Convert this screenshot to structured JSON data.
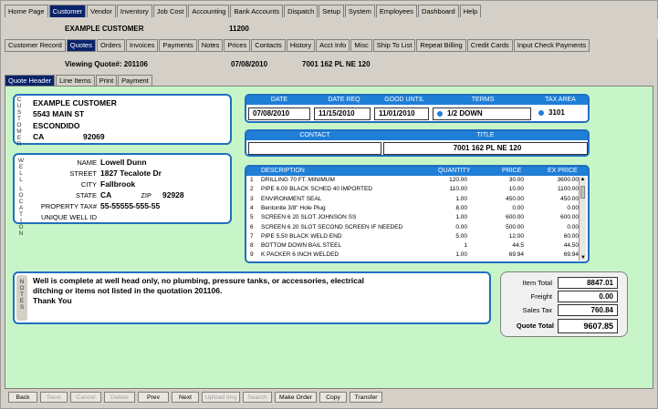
{
  "menu": [
    "Home Page",
    "Customer",
    "Vendor",
    "Inventory",
    "Job Cost",
    "Accounting",
    "Bank Accounts",
    "Dispatch",
    "Setup",
    "System",
    "Employees",
    "Dashboard",
    "Help"
  ],
  "header": {
    "customer_name": "EXAMPLE CUSTOMER",
    "customer_id": "11200"
  },
  "subtabs": [
    "Customer Record",
    "Quotes",
    "Orders",
    "Invoices",
    "Payments",
    "Notes",
    "Prices",
    "Contacts",
    "History",
    "Acct Info",
    "Misc",
    "Ship To List",
    "Repeat Billing",
    "Credit Cards",
    "Input Check Payments"
  ],
  "quote_header": {
    "viewing": "Viewing Quote#: 201106",
    "date": "07/08/2010",
    "address": "7001 162 PL NE  120"
  },
  "quote_tabs": [
    "Quote Header",
    "Line Items",
    "Print",
    "Payment"
  ],
  "customer": {
    "vertical_label": "CUSTOMER",
    "name": "EXAMPLE CUSTOMER",
    "street": "5543 MAIN ST",
    "city": "ESCONDIDO",
    "state": "CA",
    "zip": "92069"
  },
  "well": {
    "vertical_label": "WELL LOCATION",
    "name_label": "NAME",
    "name": "Lowell Dunn",
    "street_label": "STREET",
    "street": "1827 Tecalote Dr",
    "city_label": "CITY",
    "city": "Fallbrook",
    "state_label": "STATE",
    "state": "CA",
    "zip_label": "ZIP",
    "zip": "92928",
    "tax_label": "PROPERTY TAX#",
    "tax": "55-55555-555-55",
    "unique_label": "UNIQUE WELL ID",
    "unique": ""
  },
  "info": {
    "date_label": "DATE",
    "date_req_label": "DATE REQ",
    "good_until_label": "GOOD UNTIL",
    "terms_label": "TERMS",
    "tax_area_label": "TAX AREA",
    "date": "07/08/2010",
    "date_req": "11/15/2010",
    "good_until": "11/01/2010",
    "terms": "1/2 DOWN",
    "tax_area": "3101",
    "contact_label": "CONTACT",
    "title_label": "TITLE",
    "contact": "",
    "title": "7001 162 PL NE  120"
  },
  "items": {
    "headers": [
      "DESCRIPTION",
      "QUANTITY",
      "PRICE",
      "EX PRICE"
    ],
    "rows": [
      [
        "1",
        "DRILLING  70 FT. MINIMUM",
        "120.00",
        "30.00",
        "3600.00"
      ],
      [
        "2",
        "PIPE  6.00      BLACK SCHED 40 IMPORTED",
        "110.00",
        "10.00",
        "1100.00"
      ],
      [
        "3",
        "ENVIRONMENT SEAL",
        "1.00",
        "450.00",
        "450.00"
      ],
      [
        "4",
        "Bentonite 3/8\" Hole Plug",
        "8.00",
        "0.00",
        "0.00"
      ],
      [
        "5",
        "SCREEN 6    20 SLOT JOHNSON   SS",
        "1.00",
        "600.00",
        "600.00"
      ],
      [
        "6",
        "SCREEN 6 20 SLOT SECOND SCREEN IF NEEDED",
        "0.00",
        "500.00",
        "0.00"
      ],
      [
        "7",
        "PIPE  5.50      BLACK WELD END",
        "5.00",
        "12.00",
        "60.00"
      ],
      [
        "8",
        "BOTTOM DOWN BAIL STEEL",
        "1",
        "44.5",
        "44.50"
      ],
      [
        "9",
        "K PACKER  6 INCH WELDED",
        "1.00",
        "69.94",
        "69.94"
      ]
    ]
  },
  "notes": {
    "vertical_label": "NOTES",
    "text_line1": "Well is complete at well head only, no plumbing, pressure tanks, or accessories, electrical",
    "text_line2": "ditching or items not listed in the quotation 201106.",
    "text_line3": "Thank You"
  },
  "totals": {
    "item_total_label": "Item Total",
    "item_total": "8847.01",
    "freight_label": "Freight",
    "freight": "0.00",
    "sales_tax_label": "Sales Tax",
    "sales_tax": "760.84",
    "quote_total_label": "Quote Total",
    "quote_total": "9607.85"
  },
  "buttons": [
    {
      "label": "Back",
      "enabled": true
    },
    {
      "label": "Save",
      "enabled": false
    },
    {
      "label": "Cancel",
      "enabled": false
    },
    {
      "label": "Delete",
      "enabled": false
    },
    {
      "label": "Prev",
      "enabled": true
    },
    {
      "label": "Next",
      "enabled": true
    },
    {
      "label": "Upload Img",
      "enabled": false
    },
    {
      "label": "Search",
      "enabled": false
    },
    {
      "label": "Make Order",
      "enabled": true
    },
    {
      "label": "Copy",
      "enabled": true
    },
    {
      "label": "Transfer",
      "enabled": true
    }
  ],
  "colors": {
    "accent": "#1f7ed6",
    "panel_bg": "#c8f5c8",
    "active_tab": "#0a246a"
  }
}
